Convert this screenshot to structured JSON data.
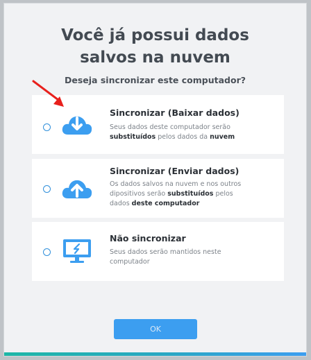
{
  "dialog": {
    "title_line1": "Você já possui dados",
    "title_line2": "salvos na nuvem",
    "subtitle": "Deseja sincronizar este computador?"
  },
  "options": [
    {
      "title": "Sincronizar (Baixar dados)",
      "icon": "cloud-download-icon",
      "desc_parts": [
        "Seus dados deste computador serão ",
        "substituídos",
        " pelos dados da ",
        "nuvem"
      ]
    },
    {
      "title": "Sincronizar (Enviar dados)",
      "icon": "cloud-upload-icon",
      "desc_parts": [
        "Os dados salvos na nuvem e nos outros dipositivos serão ",
        "substituídos",
        " pelos dados ",
        "deste computador"
      ]
    },
    {
      "title": "Não sincronizar",
      "icon": "monitor-disconnected-icon",
      "desc_parts": [
        "Seus dados serão mantidos neste computador"
      ]
    }
  ],
  "buttons": {
    "ok_label": "OK"
  },
  "colors": {
    "accent": "#3c9ef0",
    "annotation_arrow": "#e8201c",
    "bar_start": "#1db7a6",
    "bar_end": "#3c9ef0"
  }
}
